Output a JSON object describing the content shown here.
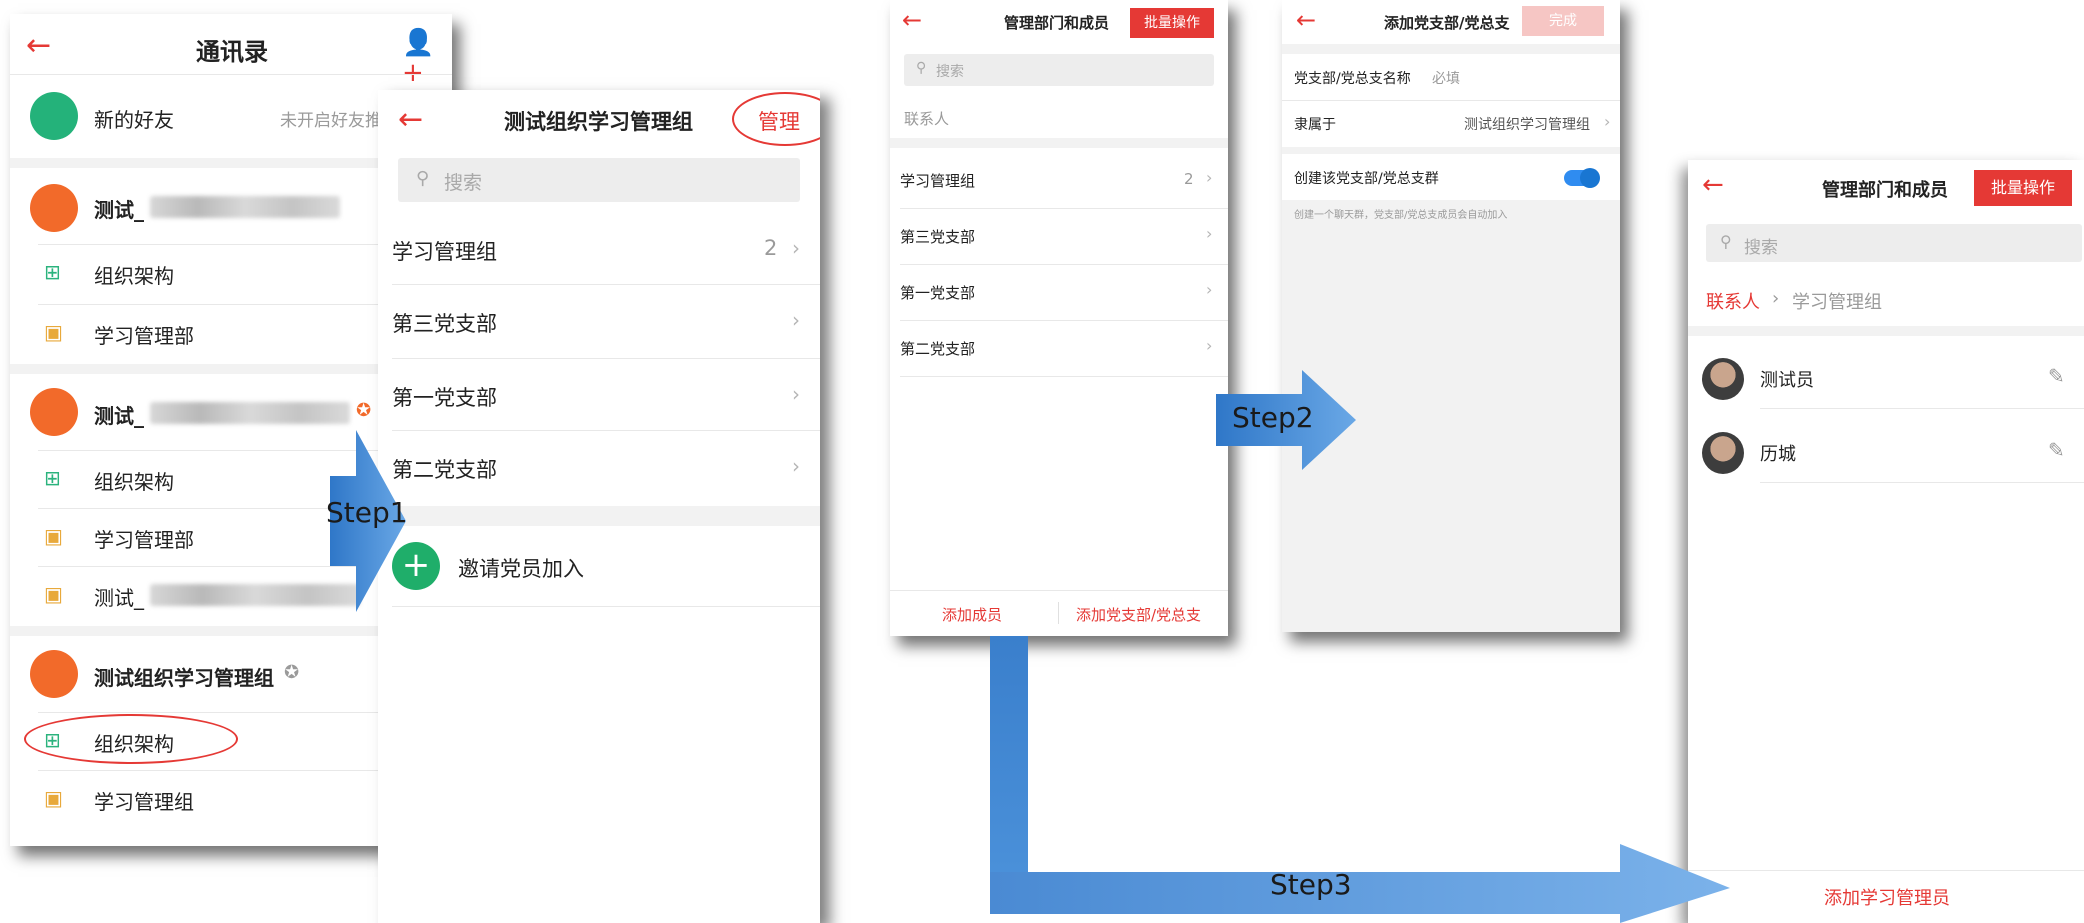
{
  "s1": {
    "title": "通讯录",
    "new_friend": "新的好友",
    "new_friend_hint": "未开启好友推",
    "org1_name": "测试_",
    "org1_items": [
      "组织架构",
      "学习管理部"
    ],
    "org2_name": "测试_",
    "org2_items": [
      "组织架构",
      "学习管理部",
      "测试_"
    ],
    "org3_name": "测试组织学习管理组",
    "org3_items": [
      "组织架构",
      "学习管理组"
    ]
  },
  "s2": {
    "title": "测试组织学习管理组",
    "manage": "管理",
    "search_placeholder": "搜索",
    "rows": [
      {
        "label": "学习管理组",
        "count": "2"
      },
      {
        "label": "第三党支部",
        "count": ""
      },
      {
        "label": "第一党支部",
        "count": ""
      },
      {
        "label": "第二党支部",
        "count": ""
      }
    ],
    "invite": "邀请党员加入"
  },
  "s3": {
    "title": "管理部门和成员",
    "batch": "批量操作",
    "search_placeholder": "搜索",
    "contacts": "联系人",
    "rows": [
      {
        "label": "学习管理组",
        "count": "2"
      },
      {
        "label": "第三党支部",
        "count": ""
      },
      {
        "label": "第一党支部",
        "count": ""
      },
      {
        "label": "第二党支部",
        "count": ""
      }
    ],
    "add_member": "添加成员",
    "add_branch": "添加党支部/党总支"
  },
  "s4": {
    "title": "添加党支部/党总支",
    "done": "完成",
    "name_label": "党支部/党总支名称",
    "name_placeholder": "必填",
    "belongs_label": "隶属于",
    "belongs_value": "测试组织学习管理组",
    "group_label": "创建该党支部/党总支群",
    "group_hint": "创建一个聊天群，党支部/党总支成员会自动加入"
  },
  "s5": {
    "title": "管理部门和成员",
    "batch": "批量操作",
    "search_placeholder": "搜索",
    "crumb_root": "联系人",
    "crumb_current": "学习管理组",
    "members": [
      "测试员",
      "历城"
    ],
    "add_admin": "添加学习管理员"
  },
  "steps": {
    "step1": "Step1",
    "step2": "Step2",
    "step3": "Step3"
  },
  "colors": {
    "accent": "#e53935",
    "arrow": "#4a90d9",
    "org_badge": "#f26a2a",
    "friend_badge": "#24b27a",
    "toggle": "#2f8cf0"
  }
}
